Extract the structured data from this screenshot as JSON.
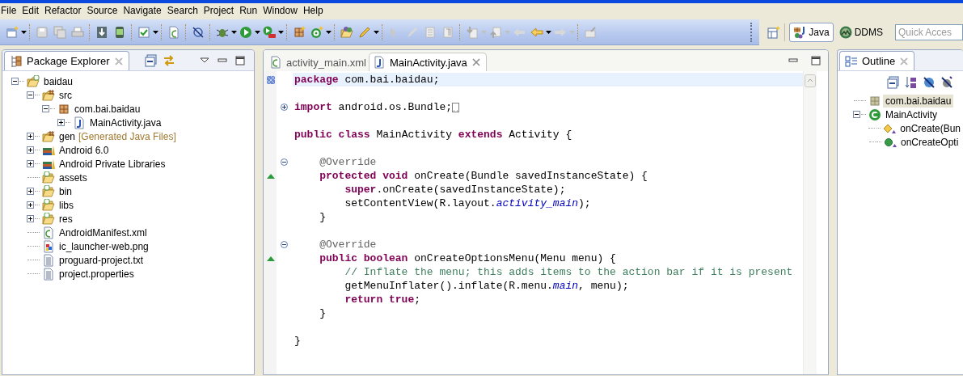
{
  "menu": [
    "File",
    "Edit",
    "Refactor",
    "Source",
    "Navigate",
    "Search",
    "Project",
    "Run",
    "Window",
    "Help"
  ],
  "perspectives": [
    {
      "label": "Java",
      "kind": "java",
      "selected": true
    },
    {
      "label": "DDMS",
      "kind": "ddms",
      "selected": false
    }
  ],
  "quick_access": {
    "placeholder": "Quick Acces"
  },
  "package_explorer": {
    "title": "Package Explorer",
    "tree": [
      {
        "label": "baidau",
        "kind": "project",
        "expanded": true,
        "selected": false,
        "children": [
          {
            "label": "src",
            "kind": "source-folder",
            "expanded": true,
            "selected": false,
            "children": [
              {
                "label": "com.bai.baidau",
                "kind": "package",
                "expanded": true,
                "selected": false,
                "children": [
                  {
                    "label": "MainActivity.java",
                    "kind": "java-file",
                    "expanded": false,
                    "selected": false
                  }
                ]
              }
            ]
          },
          {
            "label": "gen",
            "decoration": "[Generated Java Files]",
            "kind": "source-folder",
            "expanded": false,
            "selected": false
          },
          {
            "label": "Android 6.0",
            "kind": "library",
            "expanded": false,
            "selected": false
          },
          {
            "label": "Android Private Libraries",
            "kind": "library",
            "expanded": false,
            "selected": false
          },
          {
            "label": "assets",
            "kind": "folder",
            "selected": false
          },
          {
            "label": "bin",
            "kind": "folder",
            "expanded": false,
            "selected": false
          },
          {
            "label": "libs",
            "kind": "folder",
            "expanded": false,
            "selected": false
          },
          {
            "label": "res",
            "kind": "folder",
            "expanded": false,
            "selected": false
          },
          {
            "label": "AndroidManifest.xml",
            "kind": "xml-file",
            "selected": false
          },
          {
            "label": "ic_launcher-web.png",
            "kind": "image-file",
            "selected": false
          },
          {
            "label": "proguard-project.txt",
            "kind": "text-file",
            "selected": false
          },
          {
            "label": "project.properties",
            "kind": "text-file",
            "selected": false
          }
        ]
      }
    ]
  },
  "editor": {
    "tabs": [
      {
        "label": "activity_main.xml",
        "kind": "xml",
        "selected": false
      },
      {
        "label": "MainActivity.java",
        "kind": "java",
        "selected": true
      }
    ],
    "lines": [
      {
        "kind": "code",
        "current": true,
        "tokens": [
          {
            "kind": "keyword",
            "text": "package"
          },
          {
            "kind": "plain",
            "text": " com.bai.baidau;"
          }
        ]
      },
      {
        "kind": "blank"
      },
      {
        "kind": "code",
        "expanded": false,
        "tokens": [
          {
            "kind": "keyword",
            "text": "import"
          },
          {
            "kind": "plain",
            "text": " android.os.Bundle;"
          }
        ]
      },
      {
        "kind": "blank"
      },
      {
        "kind": "code",
        "tokens": [
          {
            "kind": "keyword",
            "text": "public class"
          },
          {
            "kind": "plain",
            "text": " MainActivity "
          },
          {
            "kind": "keyword",
            "text": "extends"
          },
          {
            "kind": "plain",
            "text": " Activity {"
          }
        ]
      },
      {
        "kind": "blank"
      },
      {
        "kind": "code",
        "expanded": true,
        "tokens": [
          {
            "kind": "annotation",
            "text": "    @Override"
          }
        ]
      },
      {
        "kind": "code",
        "override": true,
        "tokens": [
          {
            "kind": "keyword",
            "text": "    protected void"
          },
          {
            "kind": "plain",
            "text": " onCreate(Bundle savedInstanceState) {"
          }
        ]
      },
      {
        "kind": "code",
        "tokens": [
          {
            "kind": "keyword",
            "text": "        super"
          },
          {
            "kind": "plain",
            "text": ".onCreate(savedInstanceState);"
          }
        ]
      },
      {
        "kind": "code",
        "tokens": [
          {
            "kind": "plain",
            "text": "        setContentView(R.layout."
          },
          {
            "kind": "field",
            "text": "activity_main"
          },
          {
            "kind": "plain",
            "text": ");"
          }
        ]
      },
      {
        "kind": "code",
        "tokens": [
          {
            "kind": "plain",
            "text": "    }"
          }
        ]
      },
      {
        "kind": "blank"
      },
      {
        "kind": "code",
        "expanded": true,
        "tokens": [
          {
            "kind": "annotation",
            "text": "    @Override"
          }
        ]
      },
      {
        "kind": "code",
        "override": true,
        "tokens": [
          {
            "kind": "keyword",
            "text": "    public boolean"
          },
          {
            "kind": "plain",
            "text": " onCreateOptionsMenu(Menu menu) {"
          }
        ]
      },
      {
        "kind": "code",
        "tokens": [
          {
            "kind": "comment",
            "text": "        // Inflate the menu; this adds items to the action bar if it is present"
          }
        ]
      },
      {
        "kind": "code",
        "tokens": [
          {
            "kind": "plain",
            "text": "        getMenuInflater().inflate(R.menu."
          },
          {
            "kind": "field",
            "text": "main"
          },
          {
            "kind": "plain",
            "text": ", menu);"
          }
        ]
      },
      {
        "kind": "code",
        "tokens": [
          {
            "kind": "keyword",
            "text": "        return true"
          },
          {
            "kind": "plain",
            "text": ";"
          }
        ]
      },
      {
        "kind": "code",
        "tokens": [
          {
            "kind": "plain",
            "text": "    }"
          }
        ]
      },
      {
        "kind": "blank"
      },
      {
        "kind": "code",
        "tokens": [
          {
            "kind": "plain",
            "text": "}"
          }
        ]
      }
    ]
  },
  "outline": {
    "title": "Outline",
    "tree": [
      {
        "label": "com.bai.baidau",
        "kind": "package",
        "selected": true
      },
      {
        "label": "MainActivity",
        "kind": "class",
        "expanded": true,
        "selected": false,
        "children": [
          {
            "label": "onCreate(Bun",
            "kind": "method-protected",
            "selected": false
          },
          {
            "label": "onCreateOpti",
            "kind": "method-public",
            "selected": false
          }
        ]
      }
    ]
  }
}
